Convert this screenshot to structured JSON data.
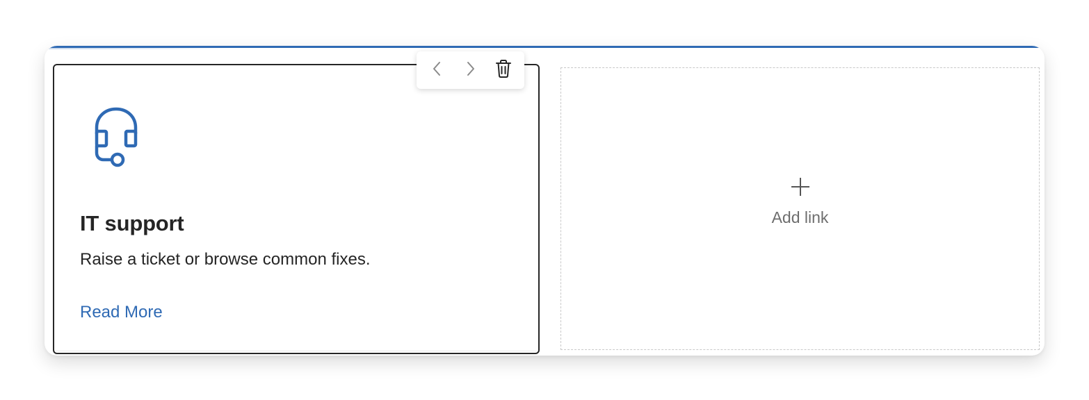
{
  "quick_links": {
    "accent_color": "#2f6ab4",
    "card": {
      "icon": "headset-icon",
      "title": "IT support",
      "description": "Raise a ticket or browse common fixes.",
      "link_label": "Read More"
    },
    "toolbar": {
      "previous_icon": "chevron-left-icon",
      "next_icon": "chevron-right-icon",
      "delete_icon": "trash-icon"
    },
    "add_tile": {
      "icon": "plus-icon",
      "label": "Add link"
    }
  }
}
